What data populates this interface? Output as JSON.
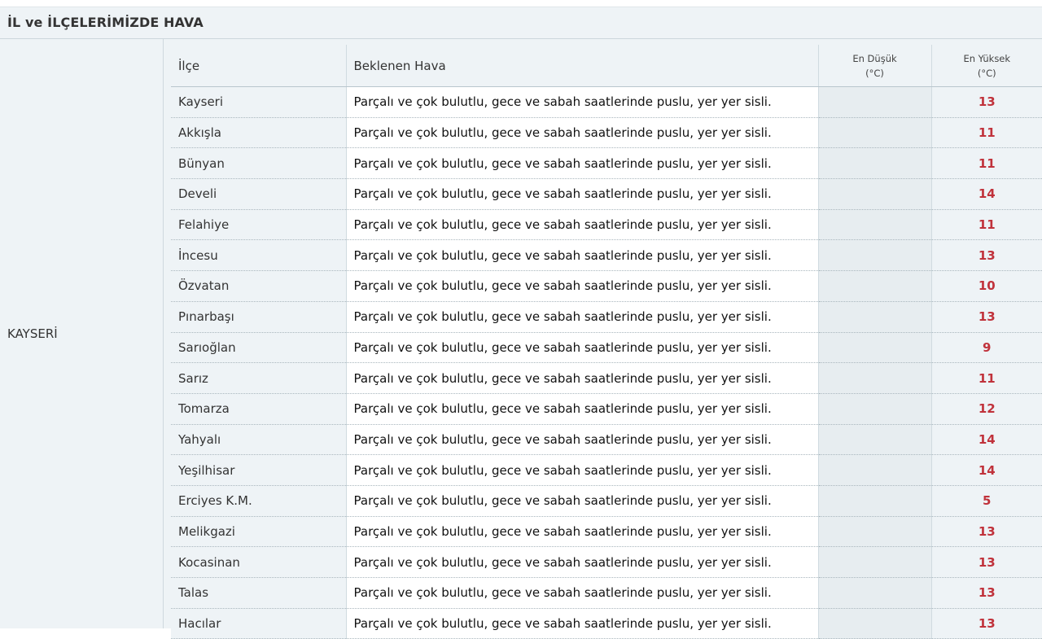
{
  "panel": {
    "title": "İL ve İLÇELERİMİZDE HAVA"
  },
  "province": "KAYSERİ",
  "table": {
    "headers": {
      "district": "İlçe",
      "forecast": "Beklenen Hava",
      "min_label": "En Düşük",
      "min_unit": "(°C)",
      "max_label": "En Yüksek",
      "max_unit": "(°C)"
    },
    "rows": [
      {
        "district": "Kayseri",
        "forecast": "Parçalı ve çok bulutlu, gece ve sabah saatlerinde puslu, yer yer sisli.",
        "min": "",
        "max": "13"
      },
      {
        "district": "Akkışla",
        "forecast": "Parçalı ve çok bulutlu, gece ve sabah saatlerinde puslu, yer yer sisli.",
        "min": "",
        "max": "11"
      },
      {
        "district": "Bünyan",
        "forecast": "Parçalı ve çok bulutlu, gece ve sabah saatlerinde puslu, yer yer sisli.",
        "min": "",
        "max": "11"
      },
      {
        "district": "Develi",
        "forecast": "Parçalı ve çok bulutlu, gece ve sabah saatlerinde puslu, yer yer sisli.",
        "min": "",
        "max": "14"
      },
      {
        "district": "Felahiye",
        "forecast": "Parçalı ve çok bulutlu, gece ve sabah saatlerinde puslu, yer yer sisli.",
        "min": "",
        "max": "11"
      },
      {
        "district": "İncesu",
        "forecast": "Parçalı ve çok bulutlu, gece ve sabah saatlerinde puslu, yer yer sisli.",
        "min": "",
        "max": "13"
      },
      {
        "district": "Özvatan",
        "forecast": "Parçalı ve çok bulutlu, gece ve sabah saatlerinde puslu, yer yer sisli.",
        "min": "",
        "max": "10"
      },
      {
        "district": "Pınarbaşı",
        "forecast": "Parçalı ve çok bulutlu, gece ve sabah saatlerinde puslu, yer yer sisli.",
        "min": "",
        "max": "13"
      },
      {
        "district": "Sarıoğlan",
        "forecast": "Parçalı ve çok bulutlu, gece ve sabah saatlerinde puslu, yer yer sisli.",
        "min": "",
        "max": "9"
      },
      {
        "district": "Sarız",
        "forecast": "Parçalı ve çok bulutlu, gece ve sabah saatlerinde puslu, yer yer sisli.",
        "min": "",
        "max": "11"
      },
      {
        "district": "Tomarza",
        "forecast": "Parçalı ve çok bulutlu, gece ve sabah saatlerinde puslu, yer yer sisli.",
        "min": "",
        "max": "12"
      },
      {
        "district": "Yahyalı",
        "forecast": "Parçalı ve çok bulutlu, gece ve sabah saatlerinde puslu, yer yer sisli.",
        "min": "",
        "max": "14"
      },
      {
        "district": "Yeşilhisar",
        "forecast": "Parçalı ve çok bulutlu, gece ve sabah saatlerinde puslu, yer yer sisli.",
        "min": "",
        "max": "14"
      },
      {
        "district": "Erciyes K.M.",
        "forecast": "Parçalı ve çok bulutlu, gece ve sabah saatlerinde puslu, yer yer sisli.",
        "min": "",
        "max": "5"
      },
      {
        "district": "Melikgazi",
        "forecast": "Parçalı ve çok bulutlu, gece ve sabah saatlerinde puslu, yer yer sisli.",
        "min": "",
        "max": "13"
      },
      {
        "district": "Kocasinan",
        "forecast": "Parçalı ve çok bulutlu, gece ve sabah saatlerinde puslu, yer yer sisli.",
        "min": "",
        "max": "13"
      },
      {
        "district": "Talas",
        "forecast": "Parçalı ve çok bulutlu, gece ve sabah saatlerinde puslu, yer yer sisli.",
        "min": "",
        "max": "13"
      },
      {
        "district": "Hacılar",
        "forecast": "Parçalı ve çok bulutlu, gece ve sabah saatlerinde puslu, yer yer sisli.",
        "min": "",
        "max": "13"
      }
    ]
  },
  "colors": {
    "max_temp": "#c0323b",
    "panel_bg": "#eef3f6"
  }
}
